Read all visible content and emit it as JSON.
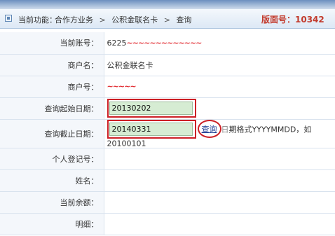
{
  "header": {
    "current_function_label": "当前功能：",
    "breadcrumb": [
      "合作方业务",
      ">",
      "公积金联名卡",
      ">",
      "查询"
    ],
    "version_text": "版面号：10342"
  },
  "form": {
    "account": {
      "label": "当前账号：",
      "value": "6225",
      "masked": "~~~~~~~~~~~~~"
    },
    "merchant_name": {
      "label": "商户名：",
      "value": "公积金联名卡"
    },
    "merchant_no": {
      "label": "商户号：",
      "masked": "~~~~~"
    },
    "start_date": {
      "label": "查询起始日期：",
      "value": "20130202"
    },
    "end_date": {
      "label": "查询截止日期：",
      "value": "20140331",
      "query_link": "查询",
      "hint_smudge": "日",
      "hint": "期格式YYYYMMDD，如20100101"
    },
    "personal_reg_no": {
      "label": "个人登记号："
    },
    "name": {
      "label": "姓名："
    },
    "balance": {
      "label": "当前余额："
    },
    "details": {
      "label": "明细："
    }
  },
  "colors": {
    "annotation_red": "#cc2026",
    "input_bg": "#d6ecd3",
    "version_red": "#c23a2c"
  }
}
